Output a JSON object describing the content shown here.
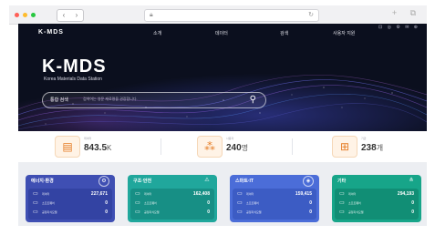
{
  "browser": {
    "nav_buttons": [
      "‹",
      "›"
    ],
    "url_icon": "lock-icon",
    "actions": "+ ⧉",
    "traffic_lights": [
      "#ff5f57",
      "#febc2e",
      "#28c840"
    ]
  },
  "header": {
    "logo": "K-MDS",
    "menu": [
      "소개",
      "데이터",
      "검색",
      "사용자 지원"
    ],
    "top_icons": "⊡ ◎ ⚙ ✉ ⊕"
  },
  "hero": {
    "title": "K-MDS",
    "subtitle": "Korea Materials Data Station",
    "search": {
      "select_label": "통합 검색",
      "placeholder": "검색어는 영문 재료명을 권장합니다."
    }
  },
  "stats": [
    {
      "label": "데이터",
      "value": "843.5",
      "unit": "K",
      "icon": "database-icon"
    },
    {
      "label": "사용자",
      "value": "240",
      "unit": "명",
      "icon": "users-network-icon"
    },
    {
      "label": "기관",
      "value": "238",
      "unit": "개",
      "icon": "org-chart-icon"
    }
  ],
  "categories": [
    {
      "title": "에너지·환경",
      "icon": "gear-icon",
      "color": "#3f4fb3",
      "rows": [
        {
          "label": "데이터",
          "value": "227,671"
        },
        {
          "label": "소프트웨어",
          "value": "0"
        },
        {
          "label": "공정지식모델",
          "value": "0"
        }
      ]
    },
    {
      "title": "구조·안전",
      "icon": "warning-icon",
      "color": "#20a79c",
      "rows": [
        {
          "label": "데이터",
          "value": "162,408"
        },
        {
          "label": "소프트웨어",
          "value": "0"
        },
        {
          "label": "공정지식모델",
          "value": "0"
        }
      ]
    },
    {
      "title": "스마트·IT",
      "icon": "chip-icon",
      "color": "#4b6dd8",
      "rows": [
        {
          "label": "데이터",
          "value": "159,415"
        },
        {
          "label": "소프트웨어",
          "value": "0"
        },
        {
          "label": "공정지식모델",
          "value": "0"
        }
      ]
    },
    {
      "title": "기타",
      "icon": "share-icon",
      "color": "#17a589",
      "rows": [
        {
          "label": "데이터",
          "value": "294,193"
        },
        {
          "label": "소프트웨어",
          "value": "0"
        },
        {
          "label": "공정지식모델",
          "value": "0"
        }
      ]
    }
  ]
}
